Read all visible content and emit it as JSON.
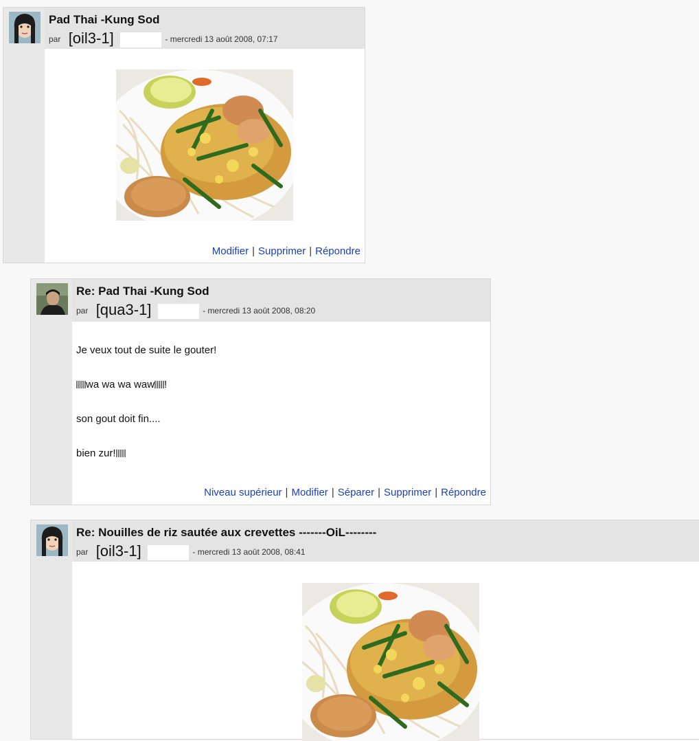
{
  "posts": [
    {
      "title": "Pad Thai -Kung Sod",
      "by": "par",
      "author": "[oil3-1]",
      "date": "- mercredi 13 août 2008, 07:17",
      "actions": [
        "Modifier",
        "Supprimer",
        "Répondre"
      ]
    },
    {
      "title": "Re: Pad Thai -Kung Sod",
      "by": "par",
      "author": "[qua3-1]",
      "date": "- mercredi 13 août 2008, 08:20",
      "lines": [
        "Je veux tout de suite le gouter!",
        "wa wa wa waw",
        "!",
        "son gout doit fin....",
        "bien zur!"
      ],
      "actions": [
        "Niveau supérieur",
        "Modifier",
        "Séparer",
        "Supprimer",
        "Répondre"
      ]
    },
    {
      "title": "Re: Nouilles de riz sautée aux crevettes -------OiL--------",
      "by": "par",
      "author": "[oil3-1]",
      "date": "- mercredi 13 août 2008, 08:41"
    }
  ],
  "colors": {
    "link": "#1a3fbf",
    "header": "#e4e4e4",
    "sidebar": "#e8e8e8"
  },
  "icons": [
    "user-avatar-girl",
    "user-avatar-dark",
    "food-photo-pad-thai"
  ]
}
